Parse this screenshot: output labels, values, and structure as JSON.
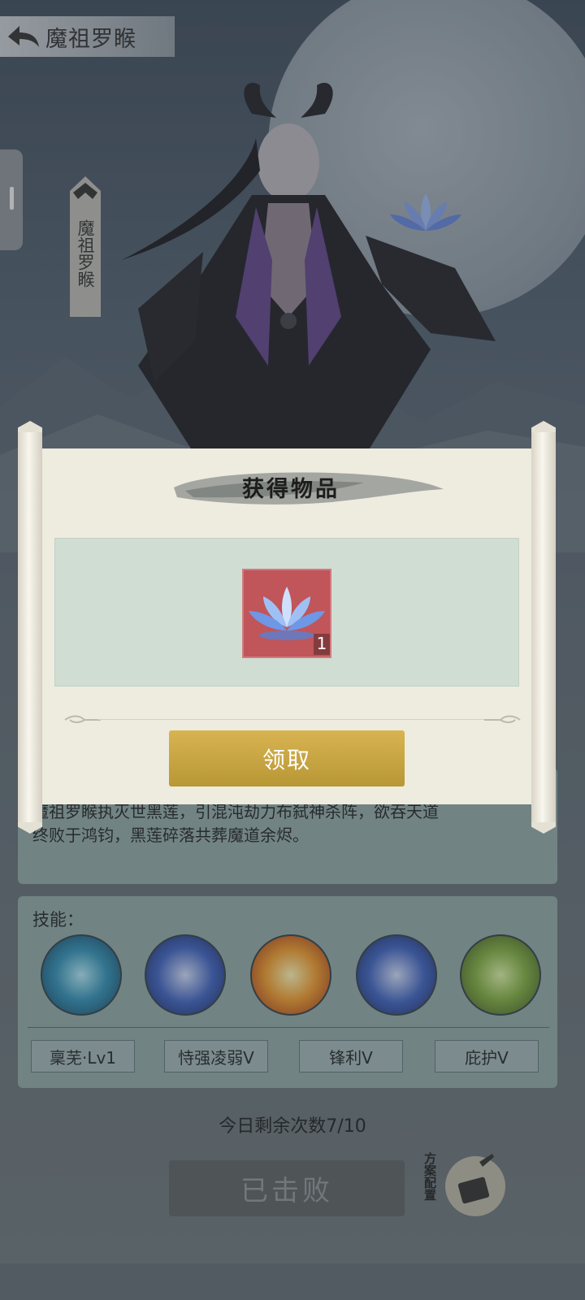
{
  "header": {
    "title": "魔祖罗睺"
  },
  "hero": {
    "name_vertical": "魔祖罗睺"
  },
  "description": {
    "text": "魔祖罗睺执灭世黑莲，引混沌劫力布弑神杀阵，欲吞天道\n终败于鸿钧，黑莲碎落共葬魔道余烬。"
  },
  "skills": {
    "label": "技能：",
    "tags": [
      "稟芜·Lv1",
      "恃强凌弱V",
      "锋利V",
      "庇护V"
    ]
  },
  "battle": {
    "remaining": "今日剩余次数7/10",
    "defeated_label": "已击败",
    "plan_label": "方案配置"
  },
  "dialog": {
    "title": "获得物品",
    "item": {
      "name": "lotus-icon",
      "count": "1"
    },
    "claim_label": "领取"
  },
  "colors": {
    "claim_button": "#c9a53f",
    "item_bg": "#c0555a",
    "scroll_paper": "#eeebdf",
    "item_area": "#cfddd3"
  }
}
